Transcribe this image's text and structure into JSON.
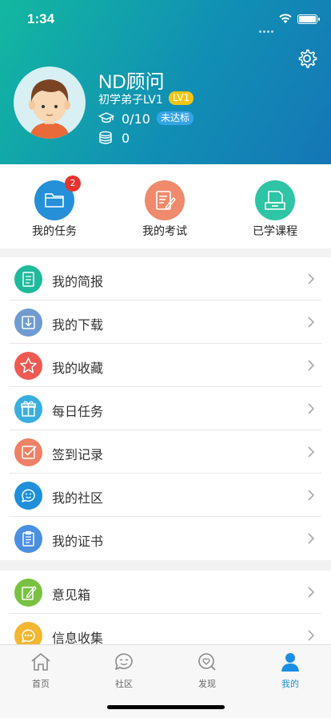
{
  "status": {
    "time": "1:34"
  },
  "profile": {
    "name": "ND顾问",
    "level_text": "初学弟子LV1",
    "level_badge": "LV1",
    "progress": "0/10",
    "progress_badge": "未达标",
    "coins": "0"
  },
  "quick_actions": [
    {
      "label": "我的任务",
      "badge": "2",
      "color": "#2590d8",
      "icon": "folder-icon"
    },
    {
      "label": "我的考试",
      "color": "#ef8a6c",
      "icon": "exam-icon"
    },
    {
      "label": "已学课程",
      "color": "#2ec4a5",
      "icon": "course-icon"
    }
  ],
  "menu_group1": [
    {
      "label": "我的简报",
      "color": "#1fb99b",
      "icon": "report-icon"
    },
    {
      "label": "我的下载",
      "color": "#6f9bd0",
      "icon": "download-icon"
    },
    {
      "label": "我的收藏",
      "color": "#ee5a52",
      "icon": "star-icon"
    },
    {
      "label": "每日任务",
      "color": "#3aaede",
      "icon": "gift-icon"
    },
    {
      "label": "签到记录",
      "color": "#ee8166",
      "icon": "checkin-icon"
    },
    {
      "label": "我的社区",
      "color": "#1e8fd8",
      "icon": "community-icon"
    },
    {
      "label": "我的证书",
      "color": "#4a8fe0",
      "icon": "certificate-icon"
    }
  ],
  "menu_group2": [
    {
      "label": "意见箱",
      "color": "#7ac142",
      "icon": "feedback-icon"
    },
    {
      "label": "信息收集",
      "color": "#f2b632",
      "icon": "info-icon"
    }
  ],
  "tabs": [
    {
      "label": "首页",
      "icon": "home-icon"
    },
    {
      "label": "社区",
      "icon": "community-tab-icon"
    },
    {
      "label": "发现",
      "icon": "discover-icon"
    },
    {
      "label": "我的",
      "icon": "profile-icon",
      "active": true
    }
  ]
}
